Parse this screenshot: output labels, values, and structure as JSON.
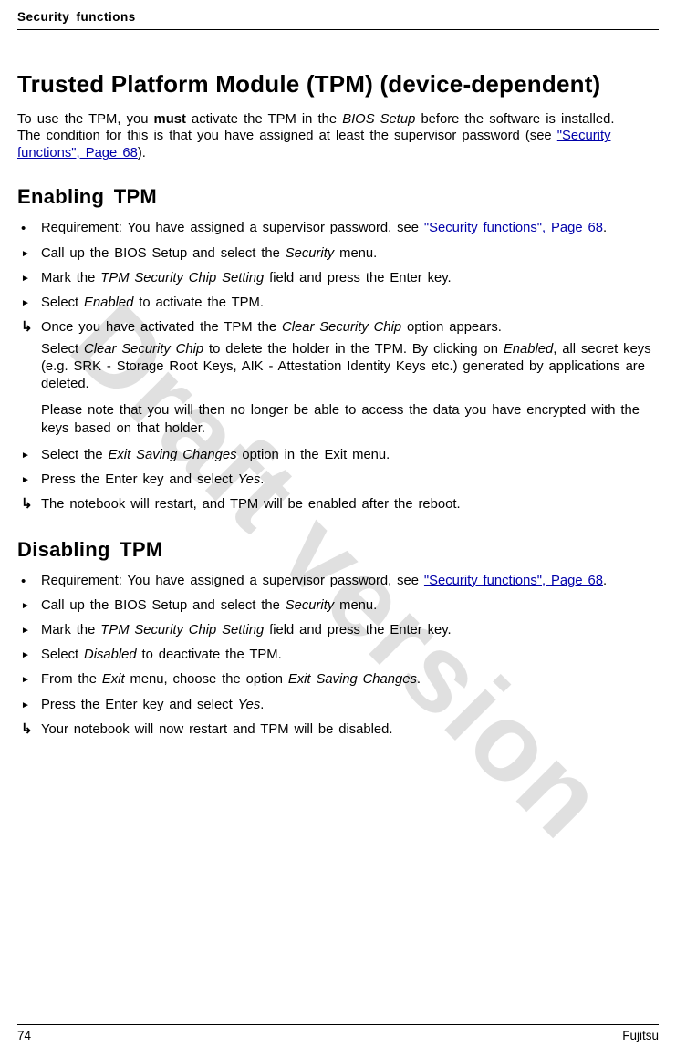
{
  "header": {
    "running": "Security functions"
  },
  "title": "Trusted Platform Module (TPM) (device-dependent)",
  "intro": {
    "p1a": "To use the TPM, you ",
    "must": "must",
    "p1b": " activate the TPM in the ",
    "bios": "BIOS Setup",
    "p1c": " before the software is installed. The condition for this is that you have assigned at least the supervisor password (see ",
    "link": "\"Security functions\", Page 68",
    "p1d": ")."
  },
  "enable": {
    "heading": "Enabling TPM",
    "req_a": "Requirement: You have assigned a supervisor password, see ",
    "req_link": "\"Security functions\", Page 68",
    "req_b": ".",
    "s1a": "Call up the BIOS Setup and select the ",
    "s1em": "Security",
    "s1b": " menu.",
    "s2a": "Mark the ",
    "s2em": "TPM Security Chip Setting",
    "s2b": " field and press the Enter key.",
    "s3a": "Select ",
    "s3em": "Enabled",
    "s3b": " to activate the TPM.",
    "r1a": "Once you have activated the TPM the ",
    "r1em": "Clear Security Chip",
    "r1b": " option appears.",
    "r2a": "Select ",
    "r2em1": "Clear Security Chip",
    "r2b": " to delete the holder in the TPM. By clicking on ",
    "r2em2": "Enabled",
    "r2c": ", all secret keys (e.g. SRK - Storage Root Keys, AIK - Attestation Identity Keys etc.) generated by applications are deleted.",
    "r3": "Please note that you will then no longer be able to access the data you have encrypted with the keys based on that holder.",
    "s4a": "Select the ",
    "s4em": "Exit Saving Changes",
    "s4b": " option in the Exit menu.",
    "s5a": "Press the Enter key and select ",
    "s5em": "Yes",
    "s5b": ".",
    "r4": "The notebook will restart, and TPM will be enabled after the reboot."
  },
  "disable": {
    "heading": "Disabling TPM",
    "req_a": "Requirement: You have assigned a supervisor password, see ",
    "req_link": "\"Security functions\", Page 68",
    "req_b": ".",
    "s1a": "Call up the BIOS Setup and select the ",
    "s1em": "Security",
    "s1b": " menu.",
    "s2a": "Mark the ",
    "s2em": "TPM Security Chip Setting",
    "s2b": " field and press the Enter key.",
    "s3a": "Select ",
    "s3em": "Disabled",
    "s3b": " to deactivate the TPM.",
    "s4a": "From the ",
    "s4em1": "Exit",
    "s4b": " menu, choose the option ",
    "s4em2": "Exit Saving Changes",
    "s4c": ".",
    "s5a": "Press the Enter key and select ",
    "s5em": "Yes",
    "s5b": ".",
    "r1": "Your notebook will now restart and TPM will be disabled."
  },
  "watermark": "Draft version",
  "footer": {
    "page": "74",
    "brand": "Fujitsu"
  }
}
